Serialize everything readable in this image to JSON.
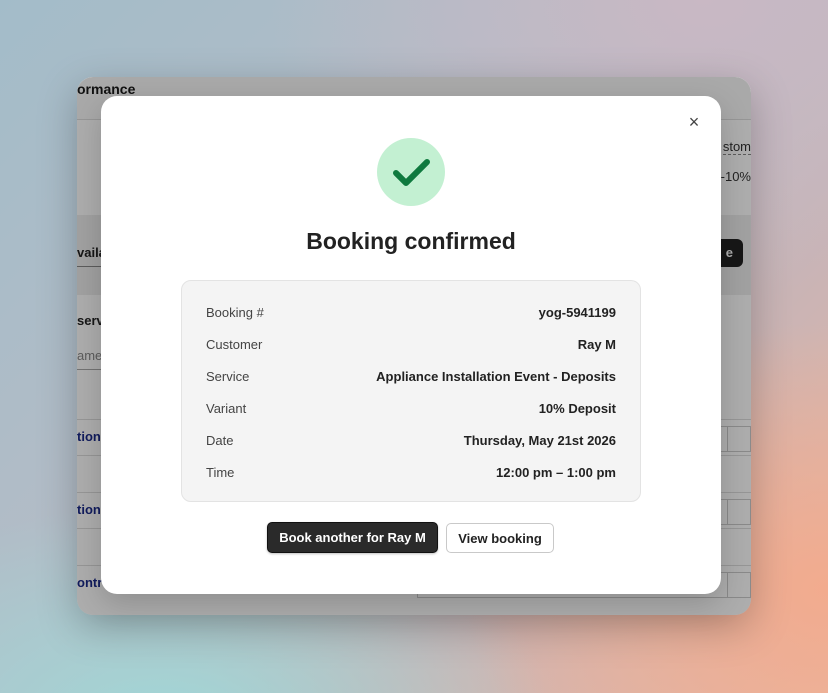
{
  "background_window": {
    "title_fragment": "ormance",
    "customer_link_fragment": "stom",
    "discount_fragment": "-10%",
    "availability_tab_fragment": "vaila",
    "add_button_fragment": "e",
    "service_label_fragment": "serv",
    "service_input_placeholder_fragment": "ame",
    "row_links": [
      "tion",
      "tion",
      "ontr"
    ]
  },
  "modal": {
    "close_label": "×",
    "icon": "check-icon",
    "title": "Booking confirmed",
    "details": [
      {
        "label": "Booking #",
        "value": "yog-5941199"
      },
      {
        "label": "Customer",
        "value": "Ray M"
      },
      {
        "label": "Service",
        "value": "Appliance Installation Event - Deposits"
      },
      {
        "label": "Variant",
        "value": "10% Deposit"
      },
      {
        "label": "Date",
        "value": "Thursday, May 21st 2026"
      },
      {
        "label": "Time",
        "value": "12:00 pm – 1:00 pm"
      }
    ],
    "primary_button": "Book another for Ray M",
    "secondary_button": "View booking"
  },
  "colors": {
    "success_circle": "#c3f0d2",
    "success_check": "#0f7a3f",
    "primary_button_bg": "#2a2a2a",
    "link_color": "#1a2a8a"
  }
}
